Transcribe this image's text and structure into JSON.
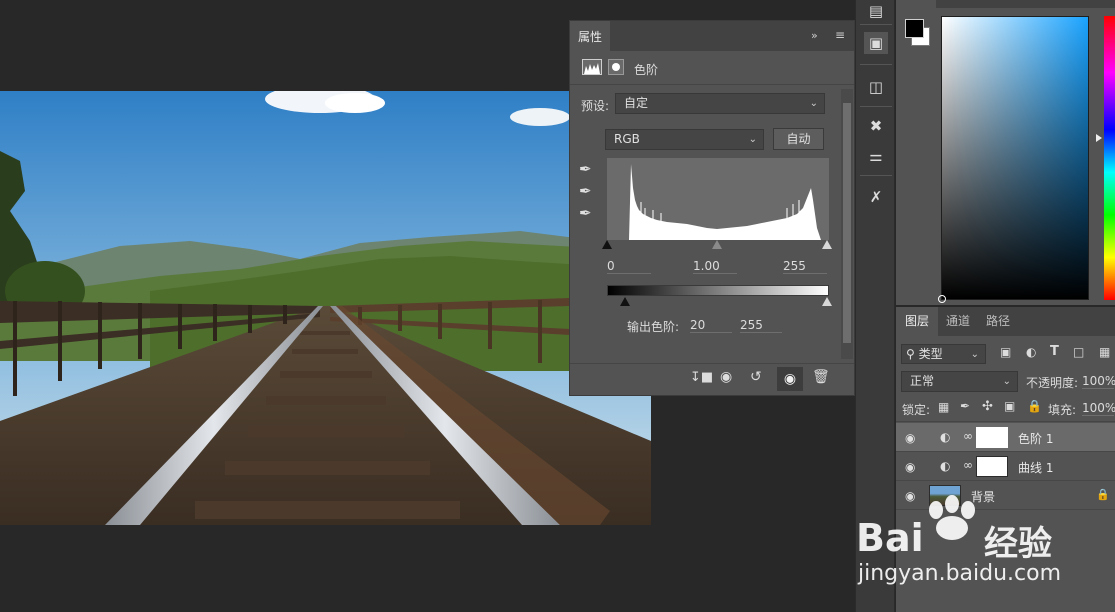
{
  "properties": {
    "tab": "属性",
    "adjustment": "色阶",
    "preset_label": "预设:",
    "preset_value": "自定",
    "channel_value": "RGB",
    "auto_button": "自动",
    "input_black": "0",
    "input_gamma": "1.00",
    "input_white": "255",
    "output_label": "输出色阶:",
    "output_black": "20",
    "output_white": "255"
  },
  "layers": {
    "tabs": [
      "图层",
      "通道",
      "路径"
    ],
    "filter_label": "类型",
    "blend_mode": "正常",
    "opacity_label": "不透明度:",
    "opacity_value": "100%",
    "lock_label": "锁定:",
    "fill_label": "填充:",
    "fill_value": "100%",
    "items": [
      {
        "name": "色阶 1"
      },
      {
        "name": "曲线 1"
      },
      {
        "name": "背景"
      }
    ]
  },
  "watermark": {
    "brand_latin": "Bai",
    "brand_cn": "经验",
    "url": "jingyan.baidu.com"
  },
  "colors": {
    "foreground": "#000000",
    "background": "#ffffff",
    "panel": "#535353",
    "canvas_bg": "#282828"
  }
}
